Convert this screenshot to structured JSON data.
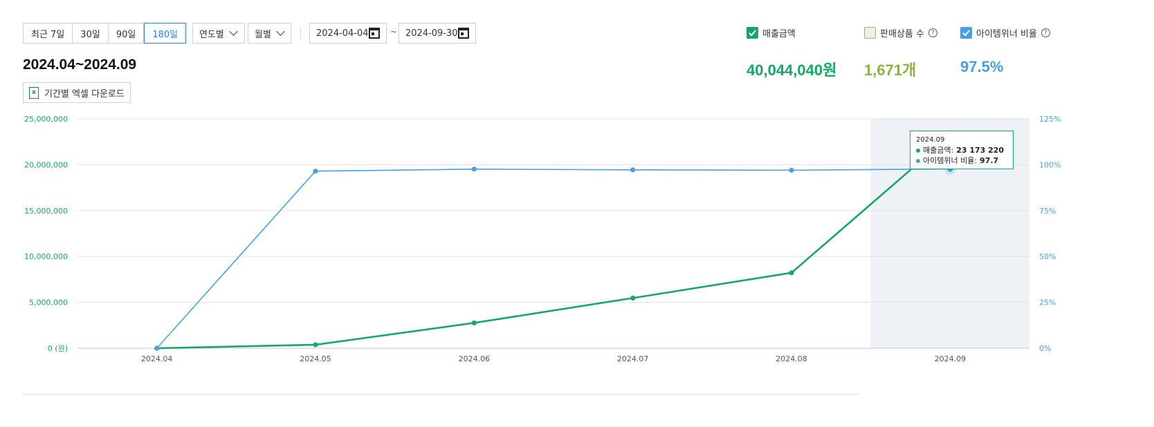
{
  "period_buttons": [
    "최근 7일",
    "30일",
    "90일",
    "180일"
  ],
  "period_active": "180일",
  "selects": {
    "year": "연도별",
    "month": "월별"
  },
  "date_range": {
    "start": "2024-04-04",
    "end": "2024-09-30",
    "separator": "~"
  },
  "period_title": "2024.04~2024.09",
  "excel_button": "기간별 엑셀 다운로드",
  "metrics": [
    {
      "label": "매출금액",
      "value": "40,044,040원",
      "checked": true,
      "color": "#16a765"
    },
    {
      "label": "판매상품 수",
      "value": "1,671개",
      "checked": false,
      "color": "#8cb33c"
    },
    {
      "label": "아이템위너 비율",
      "value": "97.5%",
      "checked": true,
      "color": "#4aa0de"
    }
  ],
  "colors": {
    "sales": "#16a765",
    "ratio": "#4aa0de",
    "accent": "#2f7ee9"
  },
  "chart_data": {
    "type": "line",
    "categories": [
      "2024.04",
      "2024.05",
      "2024.06",
      "2024.07",
      "2024.08",
      "2024.09"
    ],
    "series": [
      {
        "name": "매출금액",
        "axis": "left",
        "values": [
          0,
          380000,
          2760000,
          5470000,
          8220000,
          23173220
        ]
      },
      {
        "name": "아이템위너 비율",
        "axis": "right",
        "values": [
          0,
          96.5,
          97.6,
          97.2,
          97.0,
          97.7
        ]
      }
    ],
    "y_left": {
      "ticks": [
        "0 (원)",
        "5,000,000",
        "10,000,000",
        "15,000,000",
        "20,000,000",
        "25,000,000"
      ],
      "ylim": [
        0,
        25000000
      ]
    },
    "y_right": {
      "ticks": [
        "0%",
        "25%",
        "50%",
        "75%",
        "100%",
        "125%"
      ],
      "ylim": [
        0,
        125
      ]
    },
    "grid": true,
    "highlight_category": "2024.09"
  },
  "tooltip": {
    "date": "2024.09",
    "rows": [
      {
        "label": "매출금액:",
        "value": "23 173 220"
      },
      {
        "label": "아이템위너 비율:",
        "value": "97.7"
      }
    ]
  }
}
